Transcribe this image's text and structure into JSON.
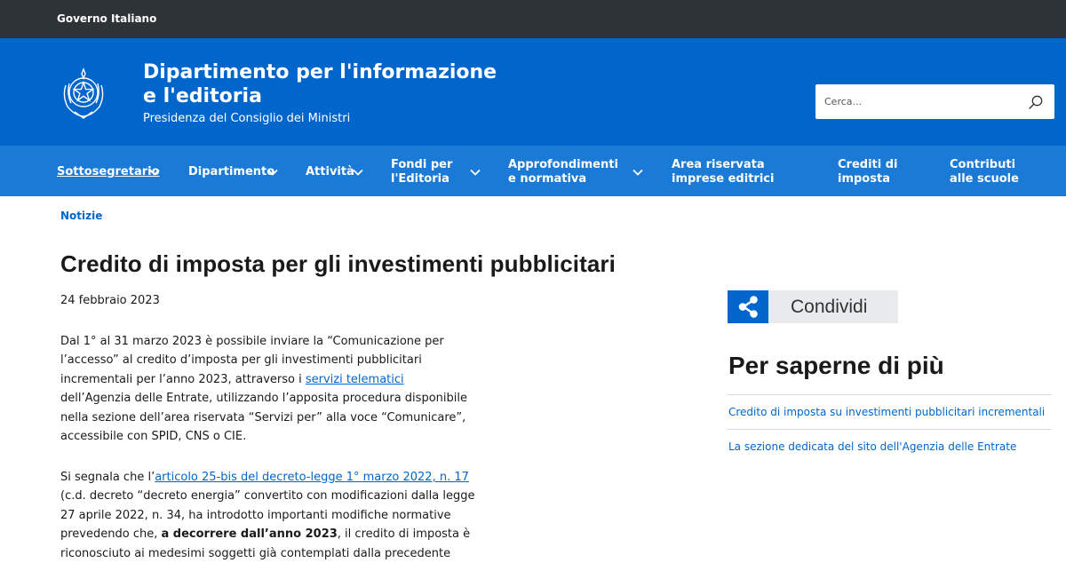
{
  "topbar": {
    "label": "Governo Italiano"
  },
  "header": {
    "title": "Dipartimento per l'informazione e l'editoria",
    "subtitle": "Presidenza del Consiglio dei Ministri",
    "emblem": "repubblica-italiana-emblem"
  },
  "search": {
    "placeholder": "Cerca...",
    "icon": "search-icon"
  },
  "nav": {
    "items": [
      {
        "label": "Sottosegretario",
        "has_dropdown": true,
        "active": true
      },
      {
        "label": "Dipartimento",
        "has_dropdown": true
      },
      {
        "label": "Attività",
        "has_dropdown": true
      },
      {
        "label": "Fondi per l'Editoria",
        "has_dropdown": true
      },
      {
        "label": "Approfondimenti e normativa",
        "has_dropdown": true
      },
      {
        "label": "Area riservata imprese editrici",
        "has_dropdown": false
      },
      {
        "label": "Crediti di imposta",
        "has_dropdown": false
      },
      {
        "label": "Contributi alle scuole",
        "has_dropdown": false
      }
    ]
  },
  "breadcrumb": {
    "label": "Notizie"
  },
  "article": {
    "title": "Credito di imposta per gli investimenti pubblicitari",
    "date": "24 febbraio 2023",
    "p1_before": "Dal 1° al 31 marzo 2023 è possibile inviare la “Comunicazione per l’accesso” al credito d’imposta per gli investimenti pubblicitari incrementali per l’anno 2023, attraverso i ",
    "p1_link": "servizi telematici",
    "p1_after": " dell’Agenzia delle Entrate, utilizzando l’apposita procedura disponibile nella sezione dell’area riservata “Servizi per” alla voce “Comunicare”, accessibile con SPID, CNS o CIE.",
    "p2_before": "Si segnala che l’",
    "p2_link": "articolo 25-bis del decreto-legge 1° marzo 2022, n. 17",
    "p2_mid": " (c.d. decreto “decreto energia” convertito con modificazioni dalla legge 27 aprile 2022, n. 34, ha introdotto importanti modifiche normative prevedendo che, ",
    "p2_bold": "a decorrere dall’anno 2023",
    "p2_after": ", il credito di imposta è riconosciuto ai medesimi soggetti già contemplati dalla precedente"
  },
  "share": {
    "label": "Condividi",
    "icon": "share-icon"
  },
  "sidebar": {
    "heading": "Per saperne di più",
    "links": [
      "Credito di imposta su investimenti pubblicitari incrementali",
      "La sezione dedicata del sito dell'Agenzia delle Entrate"
    ]
  },
  "colors": {
    "topbar": "#2e3338",
    "header": "#0066cc",
    "nav": "#1a7ad6",
    "link": "#0066cc",
    "share_bg": "#e8eaec"
  }
}
